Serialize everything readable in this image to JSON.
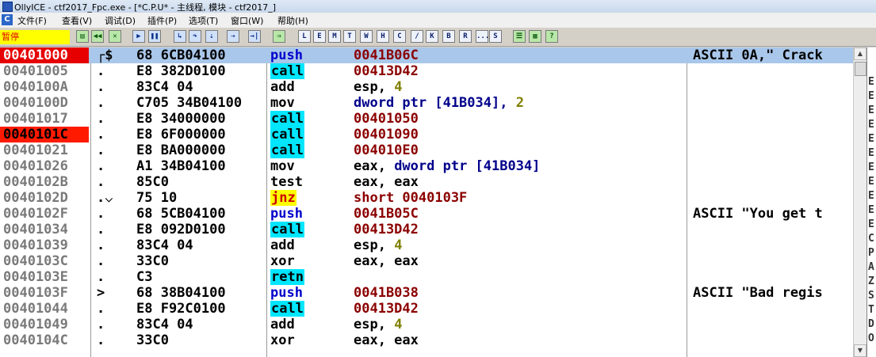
{
  "window": {
    "title": "OllyICE - ctf2017_Fpc.exe - [*C.P.U* - 主线程, 模块 - ctf2017_]"
  },
  "menu": {
    "sys_icon": "C",
    "items": [
      "文件(F)",
      "查看(V)",
      "调试(D)",
      "插件(P)",
      "选项(T)",
      "窗口(W)",
      "帮助(H)"
    ]
  },
  "toolbar": {
    "status": "暂停",
    "buttons": [
      {
        "icon": "open-icon",
        "glyph": "▤",
        "style": "green"
      },
      {
        "icon": "restart-icon",
        "glyph": "◀◀",
        "style": "green"
      },
      {
        "icon": "close-icon",
        "glyph": "✕",
        "style": "green"
      },
      {
        "icon": "run-icon",
        "glyph": "▶",
        "style": "blue"
      },
      {
        "icon": "pause-icon",
        "glyph": "❚❚",
        "style": "blue"
      },
      {
        "icon": "step-into-icon",
        "glyph": "↳",
        "style": "blue"
      },
      {
        "icon": "step-over-icon",
        "glyph": "↷",
        "style": "blue"
      },
      {
        "icon": "trace-into-icon",
        "glyph": "⇣",
        "style": "blue"
      },
      {
        "icon": "trace-over-icon",
        "glyph": "⇢",
        "style": "blue"
      },
      {
        "icon": "execute-till-return-icon",
        "glyph": "→|",
        "style": "blue"
      },
      {
        "icon": "goto-icon",
        "glyph": "⇒",
        "style": "green"
      },
      {
        "icon": "letter-l",
        "glyph": "L",
        "style": "white"
      },
      {
        "icon": "letter-e",
        "glyph": "E",
        "style": "white"
      },
      {
        "icon": "letter-m",
        "glyph": "M",
        "style": "white"
      },
      {
        "icon": "letter-t",
        "glyph": "T",
        "style": "white"
      },
      {
        "icon": "letter-w",
        "glyph": "W",
        "style": "white"
      },
      {
        "icon": "letter-h",
        "glyph": "H",
        "style": "white"
      },
      {
        "icon": "letter-c",
        "glyph": "C",
        "style": "white"
      },
      {
        "icon": "slash-icon",
        "glyph": "/",
        "style": "white"
      },
      {
        "icon": "letter-k",
        "glyph": "K",
        "style": "white"
      },
      {
        "icon": "letter-b",
        "glyph": "B",
        "style": "white"
      },
      {
        "icon": "letter-r",
        "glyph": "R",
        "style": "white"
      },
      {
        "icon": "dots-icon",
        "glyph": "...",
        "style": "white"
      },
      {
        "icon": "letter-s",
        "glyph": "S",
        "style": "white"
      },
      {
        "icon": "list-icon",
        "glyph": "☰",
        "style": "green"
      },
      {
        "icon": "grid-icon",
        "glyph": "▦",
        "style": "green"
      },
      {
        "icon": "help-icon",
        "glyph": "?",
        "style": "green"
      }
    ]
  },
  "disasm": {
    "rows": [
      {
        "addr": "00401000",
        "mark": "┌$",
        "hex": "68 6CB04100",
        "mnemonic": "push",
        "mtype": "push",
        "operand": [
          [
            "r",
            "0041B06C"
          ]
        ],
        "comment": "ASCII 0A,\" Crack",
        "addr_style": "redsel",
        "selected": true
      },
      {
        "addr": "00401005",
        "mark": ".",
        "hex": "E8 382D0100",
        "mnemonic": "call",
        "mtype": "call",
        "operand": [
          [
            "r",
            "00413D42"
          ]
        ],
        "comment": ""
      },
      {
        "addr": "0040100A",
        "mark": ".",
        "hex": "83C4 04",
        "mnemonic": "add",
        "mtype": "plain",
        "operand": [
          [
            "a",
            "esp, "
          ],
          [
            "n",
            "4"
          ]
        ],
        "comment": ""
      },
      {
        "addr": "0040100D",
        "mark": ".",
        "hex": "C705 34B04100",
        "mnemonic": "mov",
        "mtype": "plain",
        "operand": [
          [
            "m",
            "dword ptr [41B034], "
          ],
          [
            "n",
            "2"
          ]
        ],
        "comment": ""
      },
      {
        "addr": "00401017",
        "mark": ".",
        "hex": "E8 34000000",
        "mnemonic": "call",
        "mtype": "call",
        "operand": [
          [
            "r",
            "00401050"
          ]
        ],
        "comment": ""
      },
      {
        "addr": "0040101C",
        "mark": ".",
        "hex": "E8 6F000000",
        "mnemonic": "call",
        "mtype": "call",
        "operand": [
          [
            "r",
            "00401090"
          ]
        ],
        "comment": "",
        "addr_style": "red"
      },
      {
        "addr": "00401021",
        "mark": ".",
        "hex": "E8 BA000000",
        "mnemonic": "call",
        "mtype": "call",
        "operand": [
          [
            "r",
            "004010E0"
          ]
        ],
        "comment": ""
      },
      {
        "addr": "00401026",
        "mark": ".",
        "hex": "A1 34B04100",
        "mnemonic": "mov",
        "mtype": "plain",
        "operand": [
          [
            "a",
            "eax, "
          ],
          [
            "m",
            "dword ptr [41B034]"
          ]
        ],
        "comment": ""
      },
      {
        "addr": "0040102B",
        "mark": ".",
        "hex": "85C0",
        "mnemonic": "test",
        "mtype": "plain",
        "operand": [
          [
            "a",
            "eax, eax"
          ]
        ],
        "comment": ""
      },
      {
        "addr": "0040102D",
        "mark": ".⌵",
        "hex": "75 10",
        "mnemonic": "jnz",
        "mtype": "jnz",
        "operand": [
          [
            "r",
            "short 0040103F"
          ]
        ],
        "comment": ""
      },
      {
        "addr": "0040102F",
        "mark": ".",
        "hex": "68 5CB04100",
        "mnemonic": "push",
        "mtype": "push",
        "operand": [
          [
            "r",
            "0041B05C"
          ]
        ],
        "comment": "ASCII \"You get t"
      },
      {
        "addr": "00401034",
        "mark": ".",
        "hex": "E8 092D0100",
        "mnemonic": "call",
        "mtype": "call",
        "operand": [
          [
            "r",
            "00413D42"
          ]
        ],
        "comment": ""
      },
      {
        "addr": "00401039",
        "mark": ".",
        "hex": "83C4 04",
        "mnemonic": "add",
        "mtype": "plain",
        "operand": [
          [
            "a",
            "esp, "
          ],
          [
            "n",
            "4"
          ]
        ],
        "comment": ""
      },
      {
        "addr": "0040103C",
        "mark": ".",
        "hex": "33C0",
        "mnemonic": "xor",
        "mtype": "plain",
        "operand": [
          [
            "a",
            "eax, eax"
          ]
        ],
        "comment": ""
      },
      {
        "addr": "0040103E",
        "mark": ".",
        "hex": "C3",
        "mnemonic": "retn",
        "mtype": "retn",
        "operand": [],
        "comment": ""
      },
      {
        "addr": "0040103F",
        "mark": ">",
        "hex": "68 38B04100",
        "mnemonic": "push",
        "mtype": "push",
        "operand": [
          [
            "r",
            "0041B038"
          ]
        ],
        "comment": "ASCII \"Bad regis"
      },
      {
        "addr": "00401044",
        "mark": ".",
        "hex": "E8 F92C0100",
        "mnemonic": "call",
        "mtype": "call",
        "operand": [
          [
            "r",
            "00413D42"
          ]
        ],
        "comment": ""
      },
      {
        "addr": "00401049",
        "mark": ".",
        "hex": "83C4 04",
        "mnemonic": "add",
        "mtype": "plain",
        "operand": [
          [
            "a",
            "esp, "
          ],
          [
            "n",
            "4"
          ]
        ],
        "comment": ""
      },
      {
        "addr": "0040104C",
        "mark": ".",
        "hex": "33C0",
        "mnemonic": "xor",
        "mtype": "plain",
        "operand": [
          [
            "a",
            "eax, eax"
          ]
        ],
        "comment": ""
      }
    ]
  },
  "registers": {
    "letters": [
      "E",
      "E",
      "E",
      "E",
      "E",
      "E",
      "E",
      "E",
      "E",
      "E",
      "E",
      "C",
      "P",
      "A",
      "Z",
      "S",
      "T",
      "D",
      "O"
    ]
  },
  "scrollbar": {
    "up": "▲",
    "down": "▼"
  }
}
